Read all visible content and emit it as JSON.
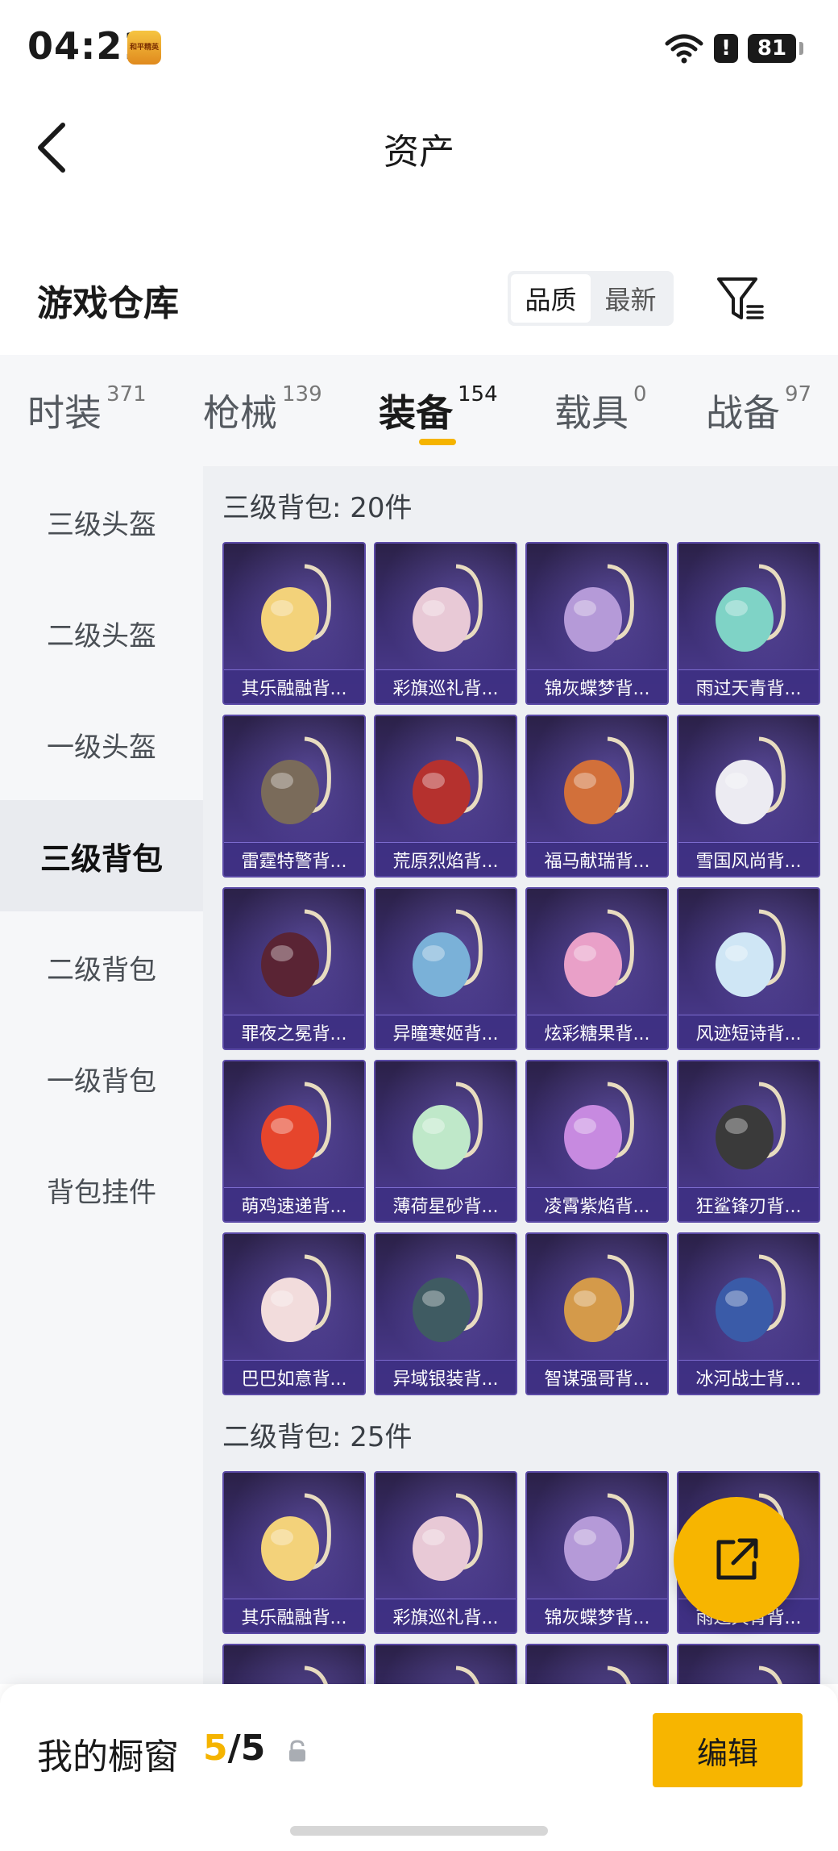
{
  "status_bar": {
    "time": "04:21",
    "app_badge": "和平精英",
    "battery": "81",
    "alert": "!"
  },
  "header": {
    "title": "资产",
    "back_icon": "chevron-left-icon"
  },
  "warehouse": {
    "title": "游戏仓库",
    "sort_options": [
      {
        "label": "品质",
        "active": true
      },
      {
        "label": "最新",
        "active": false
      }
    ],
    "filter_icon": "filter-icon"
  },
  "tabs": [
    {
      "label": "时装",
      "count": "371",
      "active": false
    },
    {
      "label": "枪械",
      "count": "139",
      "active": false
    },
    {
      "label": "装备",
      "count": "154",
      "active": true
    },
    {
      "label": "载具",
      "count": "0",
      "active": false
    },
    {
      "label": "战备",
      "count": "97",
      "active": false
    }
  ],
  "sidebar": {
    "items": [
      {
        "label": "三级头盔",
        "active": false
      },
      {
        "label": "二级头盔",
        "active": false
      },
      {
        "label": "一级头盔",
        "active": false
      },
      {
        "label": "三级背包",
        "active": true
      },
      {
        "label": "二级背包",
        "active": false
      },
      {
        "label": "一级背包",
        "active": false
      },
      {
        "label": "背包挂件",
        "active": false
      }
    ]
  },
  "sections": [
    {
      "title": "三级背包: 20件",
      "items": [
        {
          "name": "其乐融融背...",
          "color": "#f3d27a"
        },
        {
          "name": "彩旗巡礼背...",
          "color": "#e8c9d6"
        },
        {
          "name": "锦灰蝶梦背...",
          "color": "#b59ad8"
        },
        {
          "name": "雨过天青背...",
          "color": "#7fd3c6"
        },
        {
          "name": "雷霆特警背...",
          "color": "#7a6b5a"
        },
        {
          "name": "荒原烈焰背...",
          "color": "#b5312e"
        },
        {
          "name": "福马献瑞背...",
          "color": "#d2703a"
        },
        {
          "name": "雪国风尚背...",
          "color": "#ecebf2"
        },
        {
          "name": "罪夜之冕背...",
          "color": "#5a2434"
        },
        {
          "name": "异瞳寒姬背...",
          "color": "#7ab1d8"
        },
        {
          "name": "炫彩糖果背...",
          "color": "#e9a0c8"
        },
        {
          "name": "风迹短诗背...",
          "color": "#cfe6f5"
        },
        {
          "name": "萌鸡速递背...",
          "color": "#e6452c"
        },
        {
          "name": "薄荷星砂背...",
          "color": "#bfe8c9"
        },
        {
          "name": "凌霄紫焰背...",
          "color": "#c78ae0"
        },
        {
          "name": "狂鲨锋刃背...",
          "color": "#3a3a3a"
        },
        {
          "name": "巴巴如意背...",
          "color": "#f2dcdc"
        },
        {
          "name": "异域银装背...",
          "color": "#3f5b62"
        },
        {
          "name": "智谋强哥背...",
          "color": "#d49a4a"
        },
        {
          "name": "冰河战士背...",
          "color": "#3a5ba8"
        }
      ]
    },
    {
      "title": "二级背包: 25件",
      "items": [
        {
          "name": "其乐融融背...",
          "color": "#f3d27a"
        },
        {
          "name": "彩旗巡礼背...",
          "color": "#e8c9d6"
        },
        {
          "name": "锦灰蝶梦背...",
          "color": "#b59ad8"
        },
        {
          "name": "雨过天青背...",
          "color": "#7fd3c6"
        },
        {
          "name": "",
          "color": "#b5312e"
        },
        {
          "name": "",
          "color": "#d2d2e0"
        },
        {
          "name": "",
          "color": "#d2703a"
        },
        {
          "name": "",
          "color": "#3a3a3a"
        }
      ]
    }
  ],
  "share_fab": {
    "icon": "share-external-icon"
  },
  "bottom_bar": {
    "label": "我的橱窗",
    "count_current": "5",
    "count_sep": "/",
    "count_total": "5",
    "lock_icon": "lock-icon",
    "edit_label": "编辑"
  }
}
